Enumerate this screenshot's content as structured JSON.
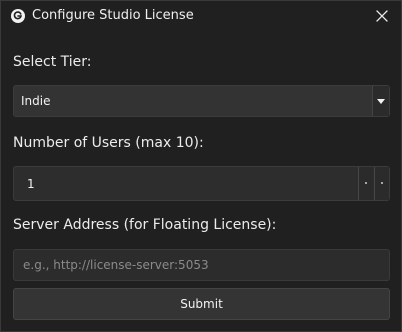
{
  "window": {
    "title": "Configure Studio License",
    "app_icon": "g-logo-icon",
    "close_icon": "close-icon"
  },
  "form": {
    "tier_label": "Select Tier:",
    "tier_value": "Indie",
    "users_label": "Number of Users (max 10):",
    "users_value": "1",
    "server_label": "Server Address (for Floating License):",
    "server_placeholder": "e.g., http://license-server:5053",
    "submit_label": "Submit"
  }
}
